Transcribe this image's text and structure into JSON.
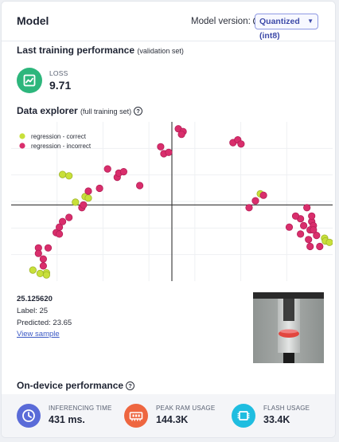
{
  "header": {
    "title": "Model",
    "model_version_label": "Model version:",
    "model_version_value": "Quantized (int8)"
  },
  "training": {
    "title": "Last training performance",
    "subtitle": "(validation set)",
    "metric_label": "LOSS",
    "metric_value": "9.71"
  },
  "explorer": {
    "title": "Data explorer",
    "subtitle": "(full training set)",
    "chart_data": {
      "type": "scatter",
      "axes_visible": false,
      "legend_position": "top-left",
      "series": [
        {
          "name": "regression - correct",
          "color": "#c8e03a",
          "points": [
            [
              -0.865,
              -0.47
            ],
            [
              -0.82,
              -0.495
            ],
            [
              -0.78,
              -0.49
            ],
            [
              -0.78,
              -0.505
            ],
            [
              -0.68,
              0.22
            ],
            [
              -0.64,
              0.21
            ],
            [
              -0.6,
              0.02
            ],
            [
              -0.54,
              0.06
            ],
            [
              -0.52,
              0.05
            ],
            [
              0.95,
              -0.24
            ],
            [
              0.955,
              -0.26
            ],
            [
              0.98,
              -0.27
            ],
            [
              0.55,
              0.08
            ]
          ]
        },
        {
          "name": "regression - incorrect",
          "color": "#d92e6c",
          "points": [
            [
              -0.83,
              -0.31
            ],
            [
              -0.83,
              -0.35
            ],
            [
              -0.8,
              -0.39
            ],
            [
              -0.77,
              -0.31
            ],
            [
              -0.8,
              -0.44
            ],
            [
              -0.72,
              -0.2
            ],
            [
              -0.7,
              -0.21
            ],
            [
              -0.7,
              -0.16
            ],
            [
              -0.68,
              -0.12
            ],
            [
              -0.64,
              -0.09
            ],
            [
              -0.56,
              -0.02
            ],
            [
              -0.55,
              0.0
            ],
            [
              -0.52,
              0.1
            ],
            [
              -0.45,
              0.12
            ],
            [
              -0.4,
              0.26
            ],
            [
              -0.34,
              0.2
            ],
            [
              -0.33,
              0.23
            ],
            [
              -0.3,
              0.24
            ],
            [
              -0.2,
              0.14
            ],
            [
              -0.07,
              0.42
            ],
            [
              -0.05,
              0.37
            ],
            [
              -0.02,
              0.38
            ],
            [
              0.04,
              0.55
            ],
            [
              0.07,
              0.53
            ],
            [
              0.06,
              0.51
            ],
            [
              0.38,
              0.45
            ],
            [
              0.41,
              0.47
            ],
            [
              0.43,
              0.44
            ],
            [
              0.8,
              -0.1
            ],
            [
              0.77,
              -0.08
            ],
            [
              0.82,
              -0.15
            ],
            [
              0.8,
              -0.21
            ],
            [
              0.73,
              -0.16
            ],
            [
              0.87,
              -0.12
            ],
            [
              0.88,
              -0.15
            ],
            [
              0.9,
              -0.22
            ],
            [
              0.85,
              -0.25
            ],
            [
              0.86,
              -0.3
            ],
            [
              0.92,
              -0.3
            ],
            [
              0.87,
              -0.08
            ],
            [
              0.86,
              -0.18
            ],
            [
              0.88,
              -0.18
            ],
            [
              0.84,
              -0.02
            ],
            [
              0.48,
              -0.02
            ],
            [
              0.52,
              0.03
            ],
            [
              0.57,
              0.07
            ]
          ]
        }
      ],
      "xlim": [
        -1,
        1
      ],
      "ylim": [
        -0.55,
        0.6
      ]
    }
  },
  "sample": {
    "x_value": "25.125620",
    "label_text": "Label: 25",
    "predicted_text": "Predicted: 23.65",
    "view_link": "View sample"
  },
  "performance": {
    "title": "On-device performance",
    "metrics": [
      {
        "label": "INFERENCING TIME",
        "value": "431 ms.",
        "color": "#5a6bd8",
        "icon": "clock-icon"
      },
      {
        "label": "PEAK RAM USAGE",
        "value": "144.3K",
        "color": "#ee6640",
        "icon": "memory-icon"
      },
      {
        "label": "FLASH USAGE",
        "value": "33.4K",
        "color": "#1fbde0",
        "icon": "chip-icon"
      }
    ]
  }
}
